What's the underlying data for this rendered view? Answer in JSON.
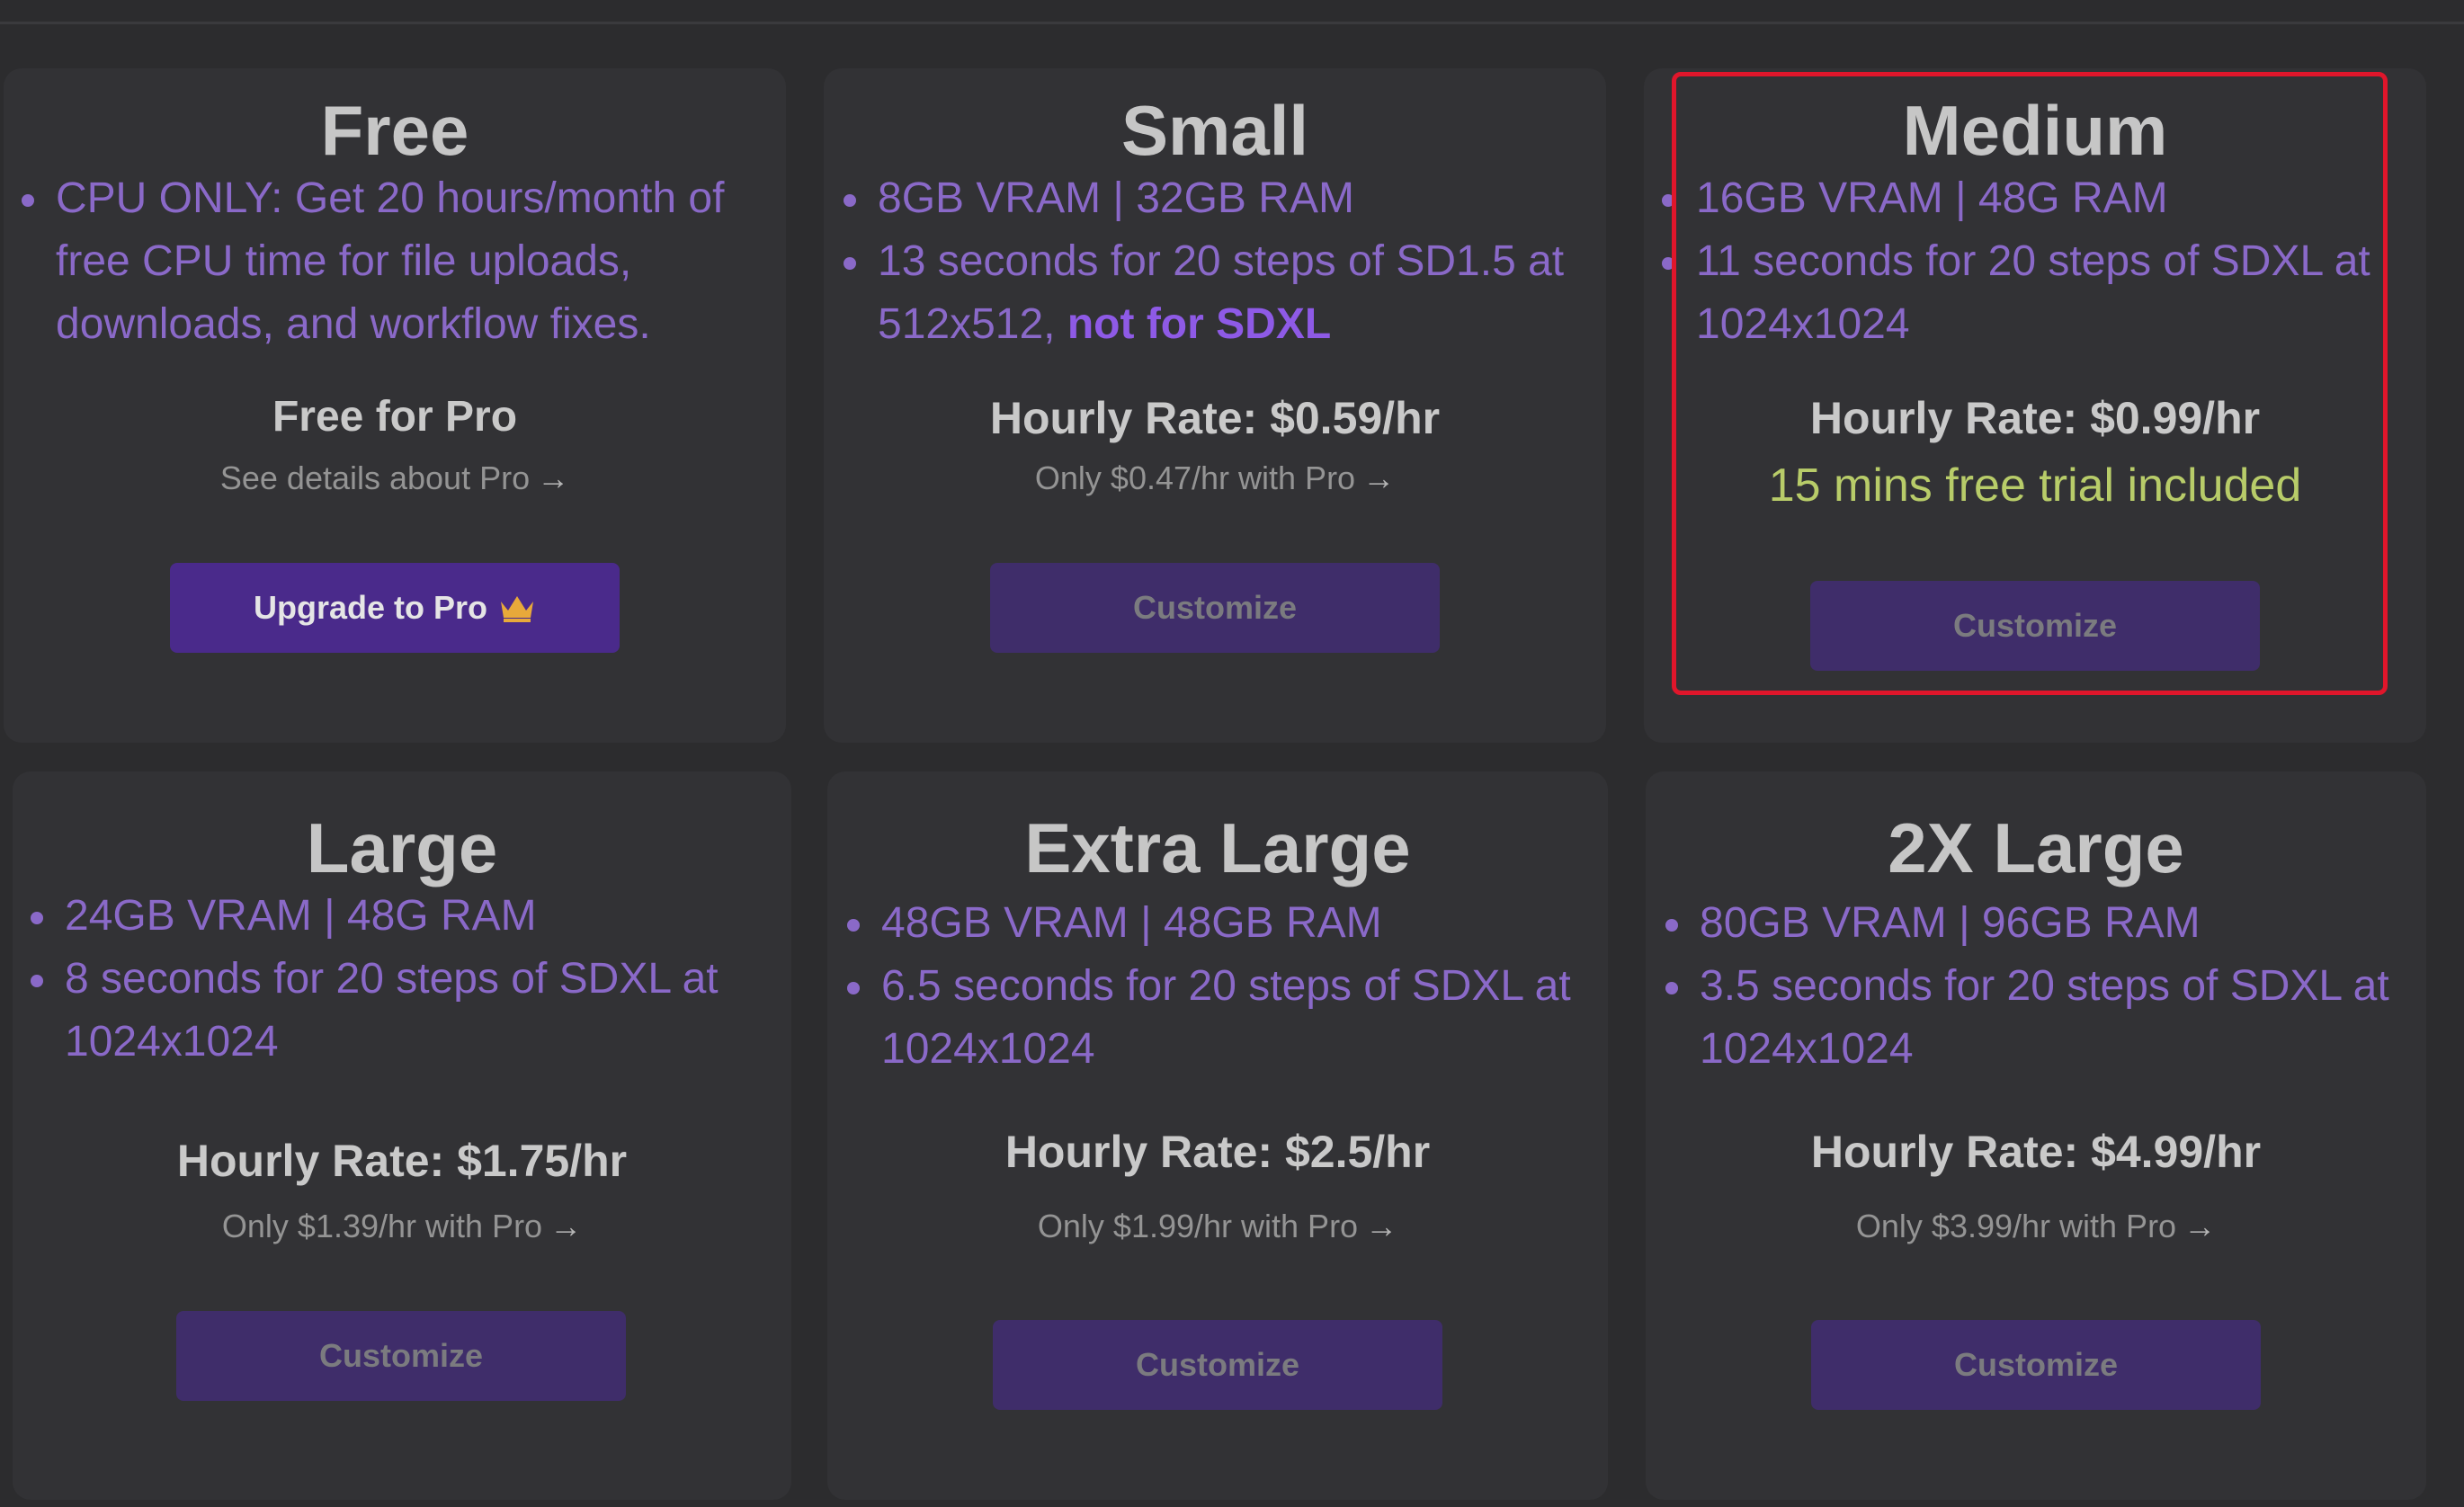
{
  "plans": [
    {
      "title": "Free",
      "bullets": [
        "CPU ONLY: Get 20 hours/month of free CPU time for file uploads, downloads, and workflow fixes."
      ],
      "rate": "Free for Pro",
      "sub": "See details about Pro",
      "button": "Upgrade to Pro"
    },
    {
      "title": "Small",
      "bullets": [
        "8GB VRAM | 32GB RAM",
        "13 seconds for 20 steps of SD1.5 at 512x512,"
      ],
      "bullet_emphasis": "not for SDXL",
      "rate": "Hourly Rate: $0.59/hr",
      "sub": "Only $0.47/hr with Pro",
      "button": "Customize"
    },
    {
      "title": "Medium",
      "bullets": [
        "16GB VRAM | 48G RAM",
        "11 seconds for 20 steps of SDXL at 1024x1024"
      ],
      "rate": "Hourly Rate: $0.99/hr",
      "trial": "15 mins free trial included",
      "button": "Customize"
    },
    {
      "title": "Large",
      "bullets": [
        "24GB VRAM | 48G RAM",
        "8 seconds for 20 steps of SDXL at 1024x1024"
      ],
      "rate": "Hourly Rate: $1.75/hr",
      "sub": "Only $1.39/hr with Pro",
      "button": "Customize"
    },
    {
      "title": "Extra Large",
      "bullets": [
        "48GB VRAM | 48GB RAM",
        "6.5 seconds for 20 steps of SDXL at 1024x1024"
      ],
      "rate": "Hourly Rate: $2.5/hr",
      "sub": "Only $1.99/hr with Pro",
      "button": "Customize"
    },
    {
      "title": "2X Large",
      "bullets": [
        "80GB VRAM | 96GB RAM",
        "3.5 seconds for 20 steps of SDXL at 1024x1024"
      ],
      "rate": "Hourly Rate: $4.99/hr",
      "sub": "Only $3.99/hr with Pro",
      "button": "Customize"
    }
  ],
  "icons": {
    "arrow": "arrow-right-icon",
    "crown": "crown-icon"
  },
  "colors": {
    "background": "#2c2c2e",
    "card": "#323235",
    "bullet_text": "#8a69c8",
    "button": "#3f2d6a",
    "primary_button": "#4a2a8b",
    "trial_text": "#b8cc69",
    "highlight_border": "#e0162b"
  }
}
